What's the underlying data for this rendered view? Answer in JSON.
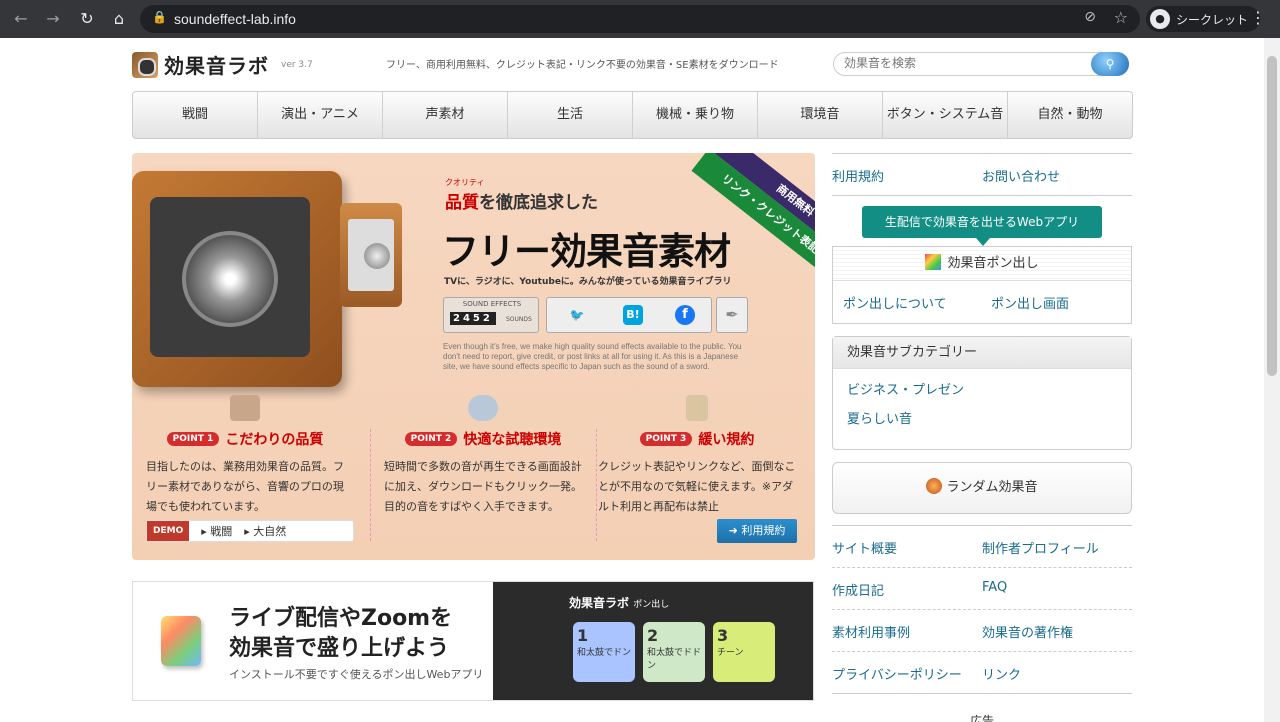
{
  "browser": {
    "url": "soundeffect-lab.info",
    "profile": "シークレット"
  },
  "site": {
    "logo_text": "効果音ラボ",
    "version": "ver 3.7",
    "tagline": "フリー、商用利用無料、クレジット表記・リンク不要の効果音・SE素材をダウンロード",
    "search_placeholder": "効果音を検索"
  },
  "nav": [
    "戦闘",
    "演出・アニメ",
    "声素材",
    "生活",
    "機械・乗り物",
    "環境音",
    "ボタン・システム音",
    "自然・動物"
  ],
  "hero": {
    "ribbon_green": "リンク・クレジット表記不要",
    "ribbon_purple": "商用無料",
    "quality_ruby": "クオリティ",
    "quality_line_red": "品質",
    "quality_line_rest": "を徹底追求した",
    "headline": "フリー効果音素材",
    "subline": "TVに、ラジオに、Youtubeに。みんなが使っている効果音ライブラリ",
    "counter_label": "SOUND EFFECTS",
    "counter_value": "2452",
    "counter_unit": "SOUNDS",
    "english": "Even though it's free, we make high quality sound effects available to the public. You don't need to report, give credit, or post links at all for using it. As this is a Japanese site, we have sound effects specific to Japan such as the sound of a sword.",
    "points": [
      {
        "badge": "POINT 1",
        "title": "こだわりの品質",
        "body": "目指したのは、業務用効果音の品質。フリー素材でありながら、音響のプロの現場でも使われています。"
      },
      {
        "badge": "POINT 2",
        "title": "快適な試聴環境",
        "body": "短時間で多数の音が再生できる画面設計に加え、ダウンロードもクリック一発。目的の音をすばやく入手できます。"
      },
      {
        "badge": "POINT 3",
        "title": "緩い規約",
        "body": "クレジット表記やリンクなど、面倒なことが不用なので気軽に使えます。※アダルト利用と再配布は禁止"
      }
    ],
    "demo_label": "DEMO",
    "demo_links": [
      "戦闘",
      "大自然"
    ],
    "terms_button": "利用規約"
  },
  "ad": {
    "line1": "ライブ配信やZoomを",
    "line2": "効果音で盛り上げよう",
    "line3": "インストール不要ですぐ使えるポン出しWebアプリ",
    "app_title": "効果音ラボ",
    "app_sub": "ポン出し",
    "pads": [
      {
        "num": "1",
        "label": "和太鼓でドン"
      },
      {
        "num": "2",
        "label": "和太鼓でドドン"
      },
      {
        "num": "3",
        "label": "チーン"
      }
    ]
  },
  "sidebar": {
    "top_links": [
      "利用規約",
      "お問い合わせ"
    ],
    "live_app_button": "生配信で効果音を出せるWebアプリ",
    "pon_title": "効果音ポン出し",
    "pon_links": [
      "ポン出しについて",
      "ポン出し画面"
    ],
    "subcat_title": "効果音サブカテゴリー",
    "subcat_items": [
      "ビジネス・プレゼン",
      "夏らしい音"
    ],
    "random": "ランダム効果音",
    "link_rows": [
      [
        "サイト概要",
        "制作者プロフィール"
      ],
      [
        "作成日記",
        "FAQ"
      ],
      [
        "素材利用事例",
        "効果音の著作権"
      ],
      [
        "プライバシーポリシー",
        "リンク"
      ]
    ],
    "ad_label": "広告"
  }
}
